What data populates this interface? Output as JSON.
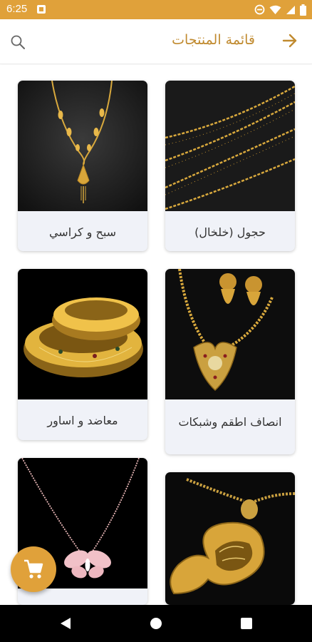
{
  "status_bar": {
    "time": "6:25",
    "icons": [
      "notification-icon",
      "do-not-disturb-icon",
      "wifi-icon",
      "signal-icon",
      "battery-icon"
    ]
  },
  "app_bar": {
    "title": "قائمة المنتجات",
    "search_icon": "search-icon",
    "back_icon": "arrow-right-icon",
    "accent_color": "#c08a2f"
  },
  "products": [
    {
      "label": "سبح و كراسي"
    },
    {
      "label": "حجول (خلخال)"
    },
    {
      "label": "معاضد و اساور"
    },
    {
      "label": "انصاف اطقم وشبكات"
    },
    {
      "label": ""
    },
    {
      "label": ""
    }
  ],
  "fab": {
    "icon": "cart-icon",
    "color": "#e0a13a"
  },
  "nav_bar": {
    "icons": [
      "back-icon",
      "home-icon",
      "recents-icon"
    ]
  }
}
